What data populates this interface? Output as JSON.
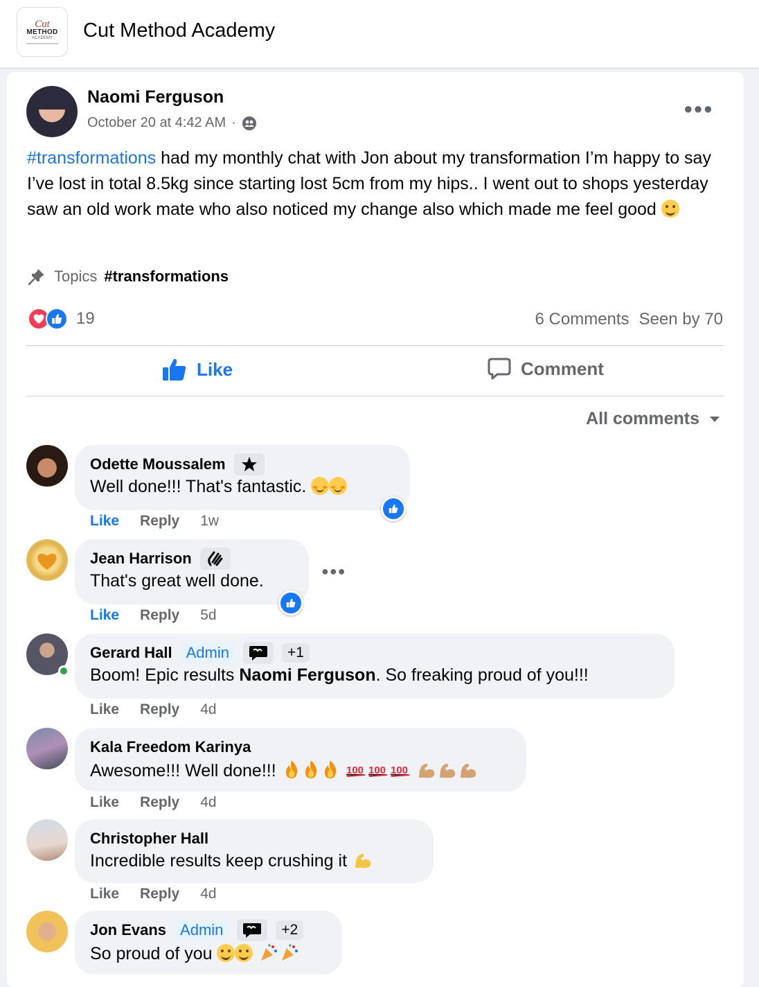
{
  "group": {
    "name": "Cut Method Academy",
    "logo_text": [
      "Cut",
      "METHOD",
      "ACADEMY"
    ]
  },
  "post": {
    "author": "Naomi Ferguson",
    "timestamp": "October 20 at 4:42 AM",
    "meta_separator": "·",
    "hashtag": "#transformations",
    "body": " had my monthly chat with Jon about my transformation I’m happy to say I’ve lost in total 8.5kg since starting lost 5cm from my hips.. I went out to shops yesterday saw an old work mate who also noticed my change also  which made me feel good",
    "topics_label": "Topics",
    "topic": "#transformations",
    "reaction_count": "19",
    "comments_count": "6 Comments",
    "seen_by": "Seen by 70",
    "like_label": "Like",
    "comment_label": "Comment",
    "sort_label": "All comments"
  },
  "comments": [
    {
      "name": "Odette Moussalem",
      "text": "Well done!!! That's fantastic.",
      "like": "Like",
      "reply": "Reply",
      "time": "1w",
      "badge_icon": "star-icon"
    },
    {
      "name": "Jean Harrison",
      "text": "That's great well done.",
      "like": "Like",
      "reply": "Reply",
      "time": "5d",
      "badge_icon": "wave-icon"
    },
    {
      "name": "Gerard Hall",
      "admin": "Admin",
      "extra": "+1",
      "text_before": "Boom! Epic results ",
      "mention": "Naomi Ferguson",
      "text_after": ". So freaking proud of you!!!",
      "like": "Like",
      "reply": "Reply",
      "time": "4d",
      "badge_icon": "conversation-icon"
    },
    {
      "name": "Kala Freedom Karinya",
      "text": "Awesome!!! Well done!!!",
      "like": "Like",
      "reply": "Reply",
      "time": "4d"
    },
    {
      "name": "Christopher Hall",
      "text": "Incredible results keep crushing it",
      "like": "Like",
      "reply": "Reply",
      "time": "4d"
    },
    {
      "name": "Jon Evans",
      "admin": "Admin",
      "extra": "+2",
      "text": "So proud of you",
      "badge_icon": "conversation-icon"
    }
  ],
  "colors": {
    "accent": "#1877f2",
    "hashtag": "#1b74e4",
    "muted": "#65676b",
    "love": "#f33e58",
    "online": "#31a24c"
  }
}
